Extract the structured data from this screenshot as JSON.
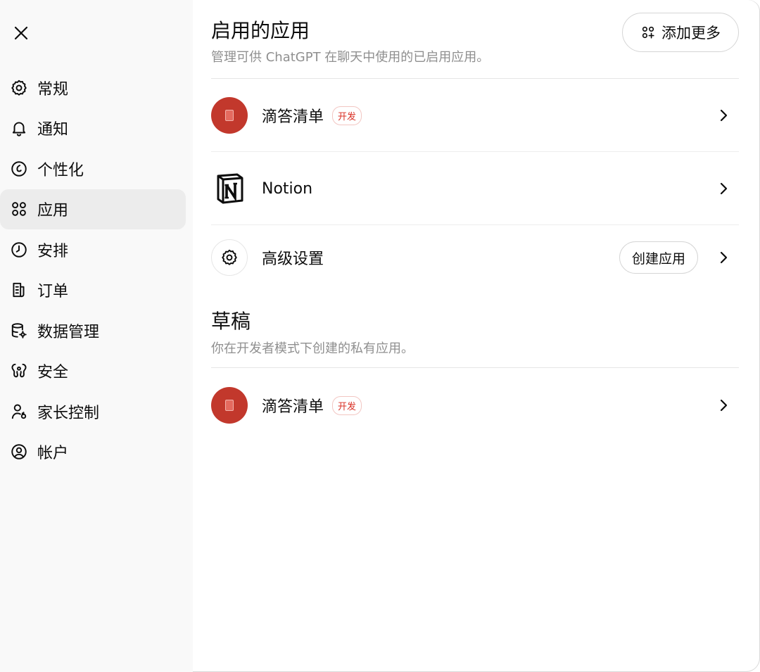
{
  "sidebar": {
    "close_icon": "close-icon",
    "items": [
      {
        "label": "常规",
        "icon": "gear-icon"
      },
      {
        "label": "通知",
        "icon": "bell-icon"
      },
      {
        "label": "个性化",
        "icon": "personalize-icon"
      },
      {
        "label": "应用",
        "icon": "apps-grid-icon",
        "active": true
      },
      {
        "label": "安排",
        "icon": "clock-icon"
      },
      {
        "label": "订单",
        "icon": "receipt-icon"
      },
      {
        "label": "数据管理",
        "icon": "database-gear-icon"
      },
      {
        "label": "安全",
        "icon": "security-icon"
      },
      {
        "label": "家长控制",
        "icon": "parental-user-icon"
      },
      {
        "label": "帐户",
        "icon": "account-circle-icon"
      }
    ]
  },
  "enabled": {
    "title": "启用的应用",
    "subtitle": "管理可供 ChatGPT 在聊天中使用的已启用应用。",
    "add_more_label": "添加更多",
    "apps": [
      {
        "name": "滴答清单",
        "badge": "开发",
        "icon": "ticktick-icon"
      },
      {
        "name": "Notion",
        "icon": "notion-logo-icon"
      }
    ],
    "advanced": {
      "name": "高级设置",
      "create_label": "创建应用",
      "icon": "gear-icon"
    }
  },
  "drafts": {
    "title": "草稿",
    "subtitle": "你在开发者模式下创建的私有应用。",
    "apps": [
      {
        "name": "滴答清单",
        "badge": "开发",
        "icon": "ticktick-icon"
      }
    ]
  },
  "colors": {
    "sidebar_bg": "#f9f9f9",
    "active_bg": "#ececec",
    "app_red": "#c2382c",
    "badge_red": "#d93025",
    "muted_text": "#8f8f8f"
  }
}
